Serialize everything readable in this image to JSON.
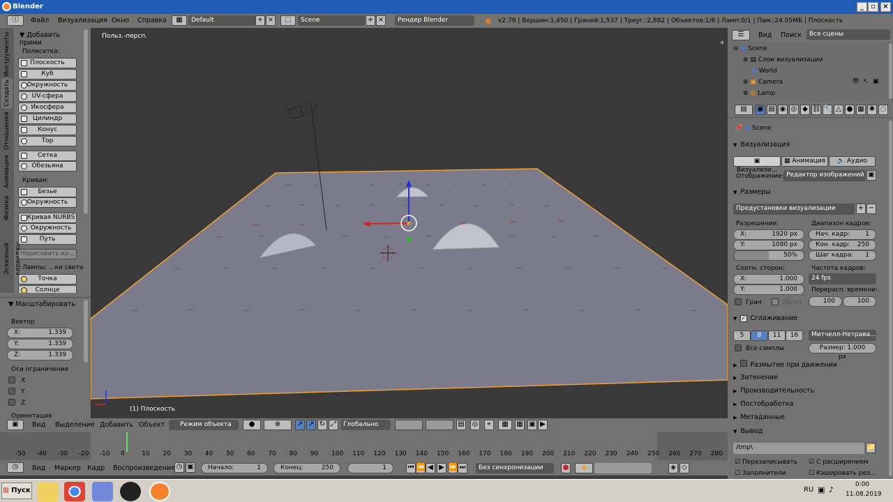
{
  "window": {
    "title": "Blender"
  },
  "topbar": {
    "menus": [
      "Файл",
      "Визуализация",
      "Окно",
      "Справка"
    ],
    "screen_layout": "Default",
    "scene": "Scene",
    "render_engine": "Рендер Blender",
    "stats": "v2.79 | Вершин:1,450 | Граней:1,537 | Треуг.:2,882 | Объектов:1/6 | Ламп:0/1 | Пам.:24.05МБ | Плоскость"
  },
  "tool_tabs": [
    "Инструменты",
    "Создать",
    "Отношения",
    "Анимация",
    "Физика",
    "Эскизный карандаш"
  ],
  "tools": {
    "header": "Добавить прими",
    "mesh_label": "Полисетка:",
    "mesh_items": [
      "Плоскость",
      "Куб",
      "Окружность",
      "UV-сфера",
      "Икосфера",
      "Цилиндр",
      "Конус",
      "Тор"
    ],
    "mesh_items2": [
      "Сетка",
      "Обезьяна"
    ],
    "curve_label": "Кривая:",
    "curve_items": [
      "Безье",
      "Окружность"
    ],
    "curve_items2": [
      "Кривая NURBS",
      "Окружность N...",
      "Путь"
    ],
    "draw_curve": "Нарисовать кр...",
    "lamps_label": "Лампы: ...ки света",
    "lamp_items": [
      "Точка",
      "Солнце"
    ]
  },
  "operator": {
    "header": "Масштабировать",
    "vector_label": "Вектор",
    "x_label": "X:",
    "x_value": "1.339",
    "y_label": "Y:",
    "y_value": "1.339",
    "z_label": "Z:",
    "z_value": "1.339",
    "constraint_label": "Оси ограничения",
    "axes": [
      "X",
      "Y",
      "Z"
    ],
    "orientation_label": "Ориентация"
  },
  "viewport": {
    "view_name": "Польз.-персп.",
    "object_label": "(1) Плоскость"
  },
  "viewport_header": {
    "menus": [
      "Вид",
      "Выделение",
      "Добавить",
      "Объект"
    ],
    "mode": "Режим объекта",
    "orientation": "Глобально"
  },
  "timeline": {
    "ticks": [
      "-50",
      "-40",
      "-30",
      "-20",
      "-10",
      "0",
      "10",
      "20",
      "30",
      "40",
      "50",
      "60",
      "70",
      "80",
      "90",
      "100",
      "110",
      "120",
      "130",
      "140",
      "150",
      "160",
      "170",
      "180",
      "190",
      "200",
      "210",
      "220",
      "230",
      "240",
      "250",
      "260",
      "270",
      "280"
    ],
    "menus": [
      "Вид",
      "Маркер",
      "Кадр",
      "Воспроизведение"
    ],
    "start_label": "Начало:",
    "start_value": "1",
    "end_label": "Конец:",
    "end_value": "250",
    "current": "1",
    "sync": "Без синхронизации"
  },
  "outliner": {
    "menus": [
      "Вид",
      "Поиск"
    ],
    "filter": "Все сцены",
    "items": [
      "Scene",
      "Слои визуализации",
      "World",
      "Camera",
      "Lamp"
    ]
  },
  "properties": {
    "context": "Scene",
    "render_section": "Визуализация",
    "render_buttons": [
      "Визуализи...",
      "Анимация",
      "Аудио"
    ],
    "display_label": "Отображение:",
    "display_value": "Редактор изображений",
    "dimensions_section": "Размеры",
    "presets": "Предустановки визуализации",
    "resolution_label": "Разрешение:",
    "res_x_label": "X:",
    "res_x": "1920 px",
    "res_y_label": "Y:",
    "res_y": "1080 px",
    "res_pct": "50%",
    "frame_range_label": "Диапазон кадров:",
    "start_label": "Нач. кадр:",
    "start_value": "1",
    "end_label": "Кон. кадр:",
    "end_value": "250",
    "step_label": "Шаг кадра:",
    "step_value": "1",
    "aspect_label": "Соотн. сторон:",
    "asp_x_label": "X:",
    "asp_x": "1.000",
    "asp_y_label": "Y:",
    "asp_y": "1.000",
    "fps_label": "Частота кадров:",
    "fps_value": "24 fps",
    "remap_label": "Перерасп. времени:",
    "remap_old": "100",
    "remap_new": "100",
    "border_label": "Гран",
    "crop_label": "Обрез",
    "aa_section": "Сглаживание",
    "aa_samples": [
      "5",
      "8",
      "11",
      "16"
    ],
    "aa_filter": "Митчелл-Нетрава...",
    "all_samples": "Все сэмплы",
    "size_label": "Размер: 1.000 px",
    "motion_blur": "Размытие при движении",
    "sections": [
      "Затенение",
      "Производительность",
      "Постобработка",
      "Метаданные"
    ],
    "output_section": "Вывод",
    "output_path": "/tmp\\",
    "overwrite": "Перезаписывать",
    "extensions": "С расширением",
    "placeholders": "Заполнители",
    "cache_result": "Кэшировать рез..."
  },
  "taskbar": {
    "start": "Пуск",
    "lang": "RU",
    "time": "0:00",
    "date": "11.08.2019"
  },
  "colors": {
    "accent": "#5680c2",
    "selection_orange": "#f0a030",
    "titlebar": "#1f5cb5"
  }
}
